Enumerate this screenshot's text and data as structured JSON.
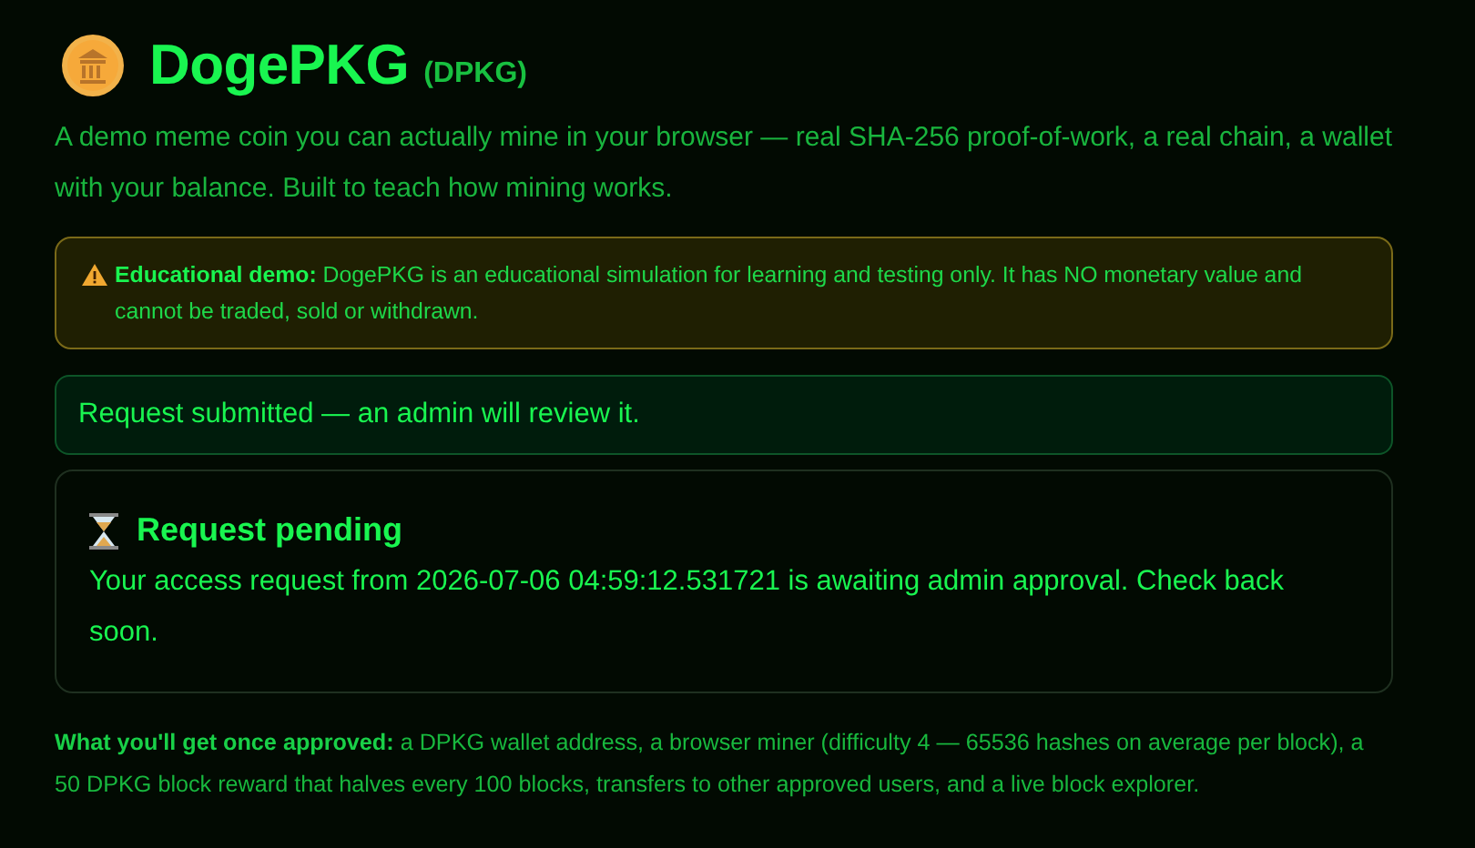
{
  "header": {
    "title": "DogePKG",
    "ticker": "(DPKG)"
  },
  "intro": "A demo meme coin you can actually mine in your browser — real SHA-256 proof-of-work, a real chain, a wallet with your balance. Built to teach how mining works.",
  "warning": {
    "text": "**Educational demo:** DogePKG is an educational simulation for learning and testing only. It has NO monetary value and cannot be traded, sold or withdrawn."
  },
  "notice": "Request submitted — an admin will review it.",
  "pending": {
    "title": "Request pending",
    "text": "Your access request from 2026-07-06 04:59:12.531721 is awaiting admin approval. Check back soon."
  },
  "footer": "**What you'll get once approved:** a DPKG wallet address, a browser miner (difficulty 4 — 65536 hashes on average per block), a 50 DPKG block reward that halves every 100 blocks, transfers to other approved users, and a live block explorer."
}
